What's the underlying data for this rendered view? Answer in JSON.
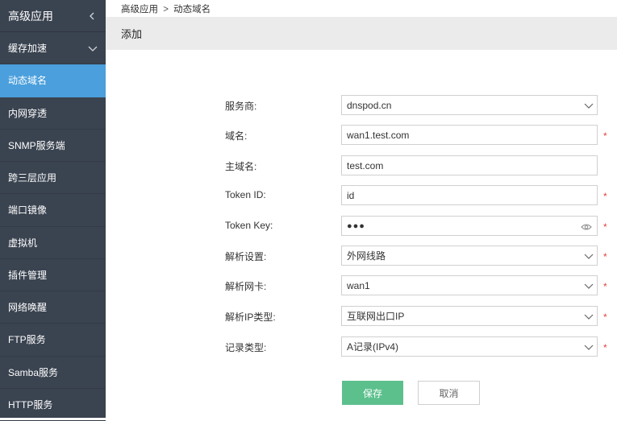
{
  "sidebar": {
    "header": "高级应用",
    "items": [
      {
        "label": "缓存加速"
      },
      {
        "label": "动态域名"
      },
      {
        "label": "内网穿透"
      },
      {
        "label": "SNMP服务端"
      },
      {
        "label": "跨三层应用"
      },
      {
        "label": "端口镜像"
      },
      {
        "label": "虚拟机"
      },
      {
        "label": "插件管理"
      },
      {
        "label": "网络唤醒"
      },
      {
        "label": "FTP服务"
      },
      {
        "label": "Samba服务"
      },
      {
        "label": "HTTP服务"
      }
    ],
    "active_index": 1
  },
  "breadcrumb": {
    "parent": "高级应用",
    "separator": ">",
    "current": "动态域名"
  },
  "page_title": "添加",
  "form": {
    "provider": {
      "label": "服务商:",
      "value": "dnspod.cn"
    },
    "domain": {
      "label": "域名:",
      "value": "wan1.test.com",
      "required": "*"
    },
    "main_domain": {
      "label": "主域名:",
      "value": "test.com"
    },
    "token_id": {
      "label": "Token ID:",
      "value": "id",
      "required": "*"
    },
    "token_key": {
      "label": "Token Key:",
      "value": "●●●",
      "required": "*"
    },
    "resolve_setting": {
      "label": "解析设置:",
      "value": "外网线路",
      "required": "*"
    },
    "resolve_nic": {
      "label": "解析网卡:",
      "value": "wan1",
      "required": "*"
    },
    "resolve_ip_type": {
      "label": "解析IP类型:",
      "value": "互联网出口IP",
      "required": "*"
    },
    "record_type": {
      "label": "记录类型:",
      "value": "A记录(IPv4)",
      "required": "*"
    }
  },
  "buttons": {
    "save": "保存",
    "cancel": "取消"
  },
  "colors": {
    "sidebar_bg": "#3a4350",
    "active": "#4a9fdc",
    "save": "#5cc08d",
    "required": "#e0433c"
  }
}
